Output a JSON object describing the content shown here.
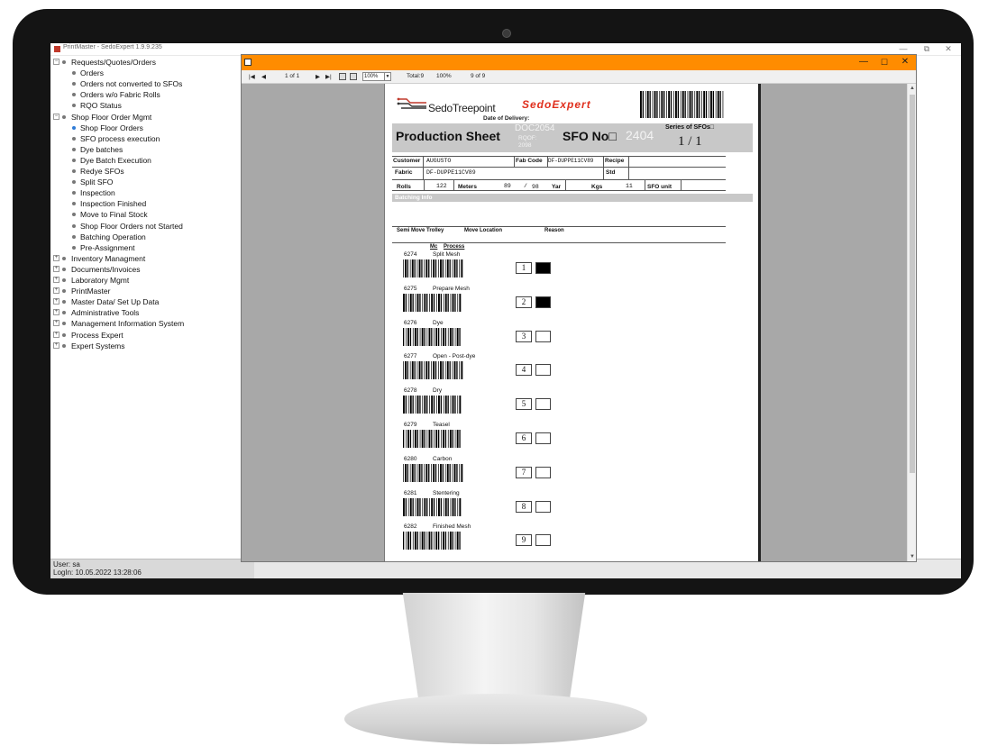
{
  "app": {
    "title": "PrintMaster - SedoExpert 1.9.9.235",
    "window_controls": [
      "—",
      "⧉",
      "✕"
    ]
  },
  "tree": [
    {
      "label": "Requests/Quotes/Orders",
      "level": 0,
      "toggle": "⊟"
    },
    {
      "label": "Orders",
      "level": 1
    },
    {
      "label": "Orders not converted to SFOs",
      "level": 1
    },
    {
      "label": "Orders w/o Fabric Rolls",
      "level": 1
    },
    {
      "label": "RQO Status",
      "level": 1
    },
    {
      "label": "Shop Floor Order Mgmt",
      "level": 0,
      "toggle": "⊟"
    },
    {
      "label": "Shop Floor Orders",
      "level": 1,
      "active": true
    },
    {
      "label": "SFO process execution",
      "level": 1
    },
    {
      "label": "Dye batches",
      "level": 1
    },
    {
      "label": "Dye Batch Execution",
      "level": 1
    },
    {
      "label": "Redye SFOs",
      "level": 1
    },
    {
      "label": "Split SFO",
      "level": 1
    },
    {
      "label": "Inspection",
      "level": 1
    },
    {
      "label": "Inspection Finished",
      "level": 1
    },
    {
      "label": "Move to Final Stock",
      "level": 1
    },
    {
      "label": "Shop Floor Orders not Started",
      "level": 1
    },
    {
      "label": "Batching Operation",
      "level": 1
    },
    {
      "label": "Pre-Assignment",
      "level": 1
    },
    {
      "label": "Inventory Managment",
      "level": 0,
      "toggle": "⊞"
    },
    {
      "label": "Documents/Invoices",
      "level": 0,
      "toggle": "⊞"
    },
    {
      "label": "Laboratory Mgmt",
      "level": 0,
      "toggle": "⊞"
    },
    {
      "label": "PrintMaster",
      "level": 0,
      "toggle": "⊞"
    },
    {
      "label": "Master Data/ Set Up Data",
      "level": 0,
      "toggle": "⊞"
    },
    {
      "label": "Administrative Tools",
      "level": 0,
      "toggle": "⊞"
    },
    {
      "label": "Management Information System",
      "level": 0,
      "toggle": "⊞"
    },
    {
      "label": "Process Expert",
      "level": 0,
      "toggle": "⊞"
    },
    {
      "label": "Expert Systems",
      "level": 0,
      "toggle": "⊞"
    }
  ],
  "status": {
    "user": "User: sa",
    "login": "LogIn: 10.05.2022 13:28:06"
  },
  "report_window": {
    "controls": [
      "—",
      "☐",
      "✕"
    ],
    "toolbar": {
      "first": "|◀",
      "prev": "◀",
      "page_of": "1 of 1",
      "next": "▶",
      "last": "▶|",
      "zoom": "100%",
      "total": "Total:9",
      "percent": "100%",
      "count": "9 of 9"
    },
    "scroll_up": "▲",
    "scroll_down": "▼"
  },
  "report": {
    "logo_name": "SedoTreepoint",
    "brand": "SedoExpert",
    "date_of_delivery_label": "Date of Delivery:",
    "title": "Production Sheet",
    "doc_number": "DOC2054",
    "rqof_label": "RQOF:",
    "rqof_value": "2098",
    "sfo_label": "SFO No",
    "sfo_number": "2404",
    "series_label": "Series of SFOs",
    "series_value": "1 /  1",
    "customer_label": "Customer",
    "customer_value": "AUGUSTO",
    "fab_code_label": "Fab Code",
    "fab_code_value": "DF-DUPPE11CV89",
    "recipe_label": "Recipe",
    "fabric_label": "Fabric",
    "fabric_value": "DF-DUPPE11CV89",
    "std_label": "Std",
    "rolls_label": "Rolls",
    "rolls_value": "122",
    "meters_label": "Meters",
    "meters_value": "89",
    "meters_sep": "/",
    "meters_value2": "98",
    "yar_label": "Yar",
    "kgs_label": "Kgs",
    "kgs_value": "11",
    "sfo_unit_label": "SFO unit",
    "batching_info": "Batching Info",
    "col_semi_move_trolley": "Semi Move Trolley",
    "col_move_location": "Move Location",
    "col_reason": "Reason",
    "col_mc": "Mc",
    "col_process": "Process",
    "processes": [
      {
        "no": "6274",
        "name": "Split Mesh",
        "box": "1",
        "done": true
      },
      {
        "no": "6275",
        "name": "Prepare Mesh",
        "box": "2",
        "done": true
      },
      {
        "no": "6276",
        "name": "Dye",
        "box": "3",
        "done": false
      },
      {
        "no": "6277",
        "name": "Open - Post-dye",
        "box": "4",
        "done": false
      },
      {
        "no": "6278",
        "name": "Dry",
        "box": "5",
        "done": false
      },
      {
        "no": "6279",
        "name": "Teasel",
        "box": "6",
        "done": false
      },
      {
        "no": "6280",
        "name": "Carbon",
        "box": "7",
        "done": false
      },
      {
        "no": "6281",
        "name": "Stentering",
        "box": "8",
        "done": false
      },
      {
        "no": "6282",
        "name": "Finished Mesh",
        "box": "9",
        "done": false
      }
    ]
  },
  "colors": {
    "orange_titlebar": "#ff8c00",
    "brand_red": "#e0301e",
    "band_gray": "#c8c8c8",
    "active_bullet": "#2e7bd6"
  }
}
